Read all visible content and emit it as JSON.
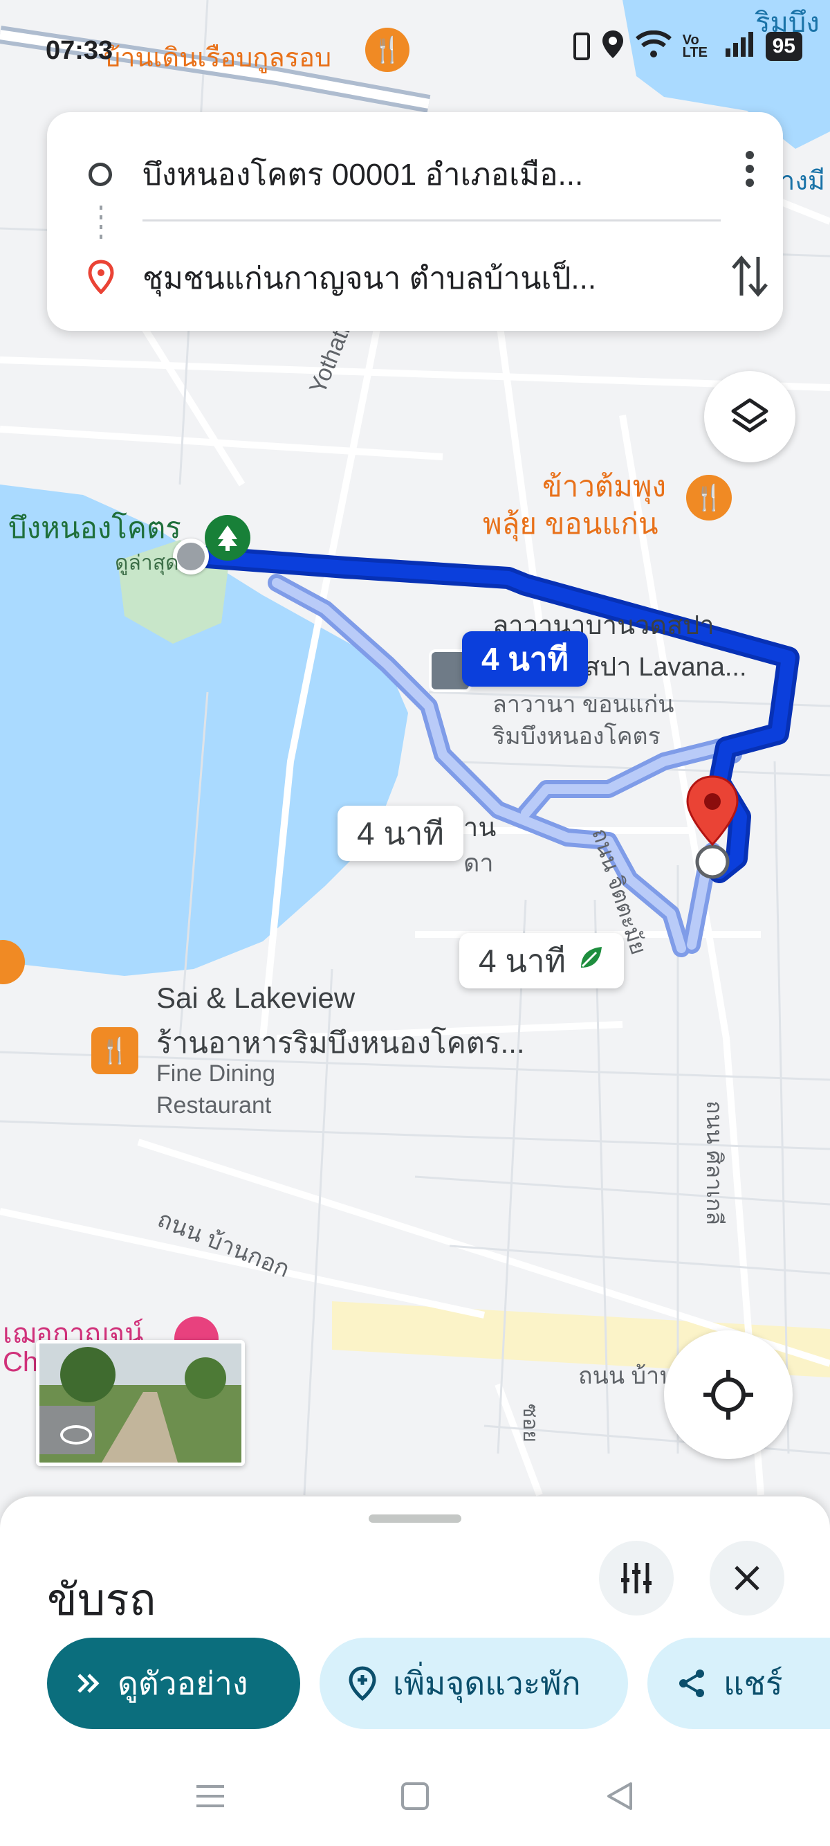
{
  "status_bar": {
    "time": "07:33",
    "battery": "95",
    "network": "Vo LTE"
  },
  "search": {
    "origin": "บึงหนองโคตร 00001 อำเภอเมือ...",
    "destination": "ชุมชนแก่นกาญจนา ตำบลบ้านเป็...",
    "more_icon": "more-vert-icon",
    "swap_icon": "swap-vertical-icon"
  },
  "map": {
    "labels": {
      "lake": "บึงหนองโคตร",
      "lake_sub": "ดูล่าสุด",
      "road_yothathikan": "Yothathikan Kho",
      "restaurant_top": "บ้านเดินเรือบกูลรอบ",
      "khaotom_1": "ข้าวต้มพุง",
      "khaotom_2": "พลุ้ย ขอนแก่น",
      "spa_1": "ลาวานาบานวดสปา",
      "spa_2": "นวดสปา Lavana...",
      "spa_3": "ลาวานา ขอนแก่น",
      "spa_4": "ริมบึงหนองโคตร",
      "partial_1": "าน",
      "partial_2": "ดา",
      "road_jitchamai": "ถนน จิตตะมัย",
      "sai_1": "Sai & Lakeview",
      "sai_2": "ร้านอาหารริมบึงหนองโคตร...",
      "sai_3": "Fine Dining",
      "sai_4": "Restaurant",
      "road_bankok": "ถนน บ้านกอก",
      "road_ban": "ถนน บ้าน",
      "road_sinlakhao": "ถนน ศิลาเกลี",
      "soi": "ซอย",
      "pink_place": "เฌอกาญจน์",
      "pink_place_2": "Ch",
      "top_right": "ริมบึง",
      "top_right_2": "างมี"
    },
    "route_times": {
      "active": "4 นาที",
      "alt": "4 นาที",
      "eco": "4 นาที"
    },
    "layers_icon": "layers-icon",
    "locate_icon": "my-location-icon"
  },
  "sheet": {
    "title": "ขับรถ",
    "options_icon": "tune-icon",
    "close_icon": "close-icon",
    "preview_label": "ดูตัวอย่าง",
    "add_stop_label": "เพิ่มจุดแวะพัก",
    "share_label": "แชร์"
  },
  "colors": {
    "route_active": "#0b3fdc",
    "route_alt": "#9db3f5",
    "water": "#aadaff",
    "primary_button": "#0b6e7d",
    "secondary_button": "#d8f1fb",
    "poi_orange": "#f08a24"
  }
}
